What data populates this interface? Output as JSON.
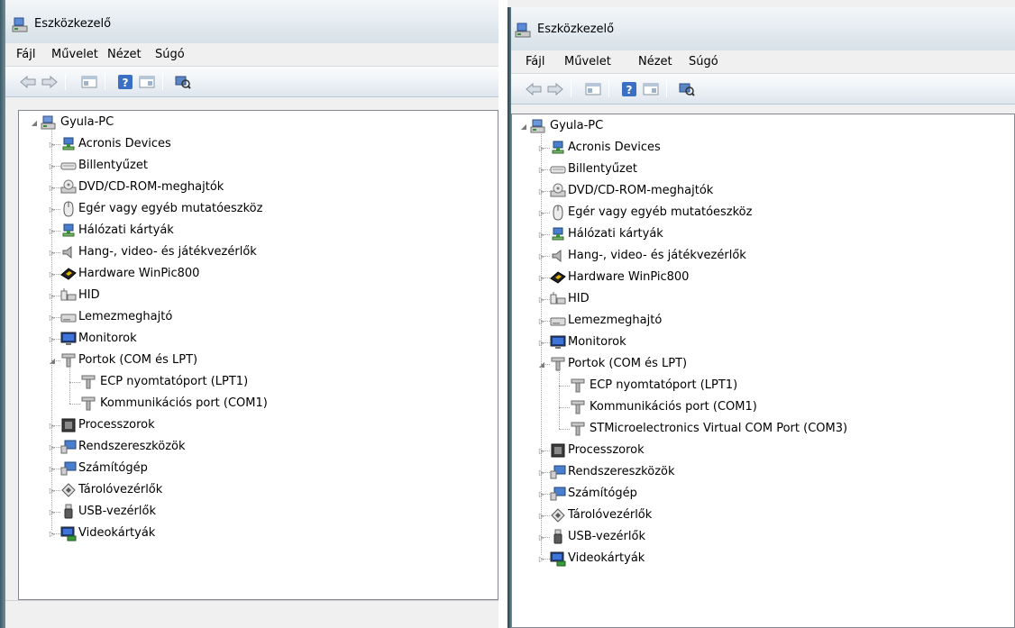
{
  "left_window": {
    "title": "Eszközkezelő",
    "menu": [
      "Fájl",
      "Művelet",
      "Nézet",
      "Súgó"
    ],
    "toolbar_icons": [
      "back-arrow-icon",
      "forward-arrow-icon",
      "properties-view-icon",
      "help-icon",
      "details-view-icon",
      "scan-hardware-icon"
    ],
    "root": "Gyula-PC",
    "categories": [
      {
        "label": "Acronis Devices",
        "icon": "network-icon"
      },
      {
        "label": "Billentyűzet",
        "icon": "keyboard-icon"
      },
      {
        "label": "DVD/CD-ROM-meghajtók",
        "icon": "dvd-drive-icon"
      },
      {
        "label": "Egér vagy egyéb mutatóeszköz",
        "icon": "mouse-icon"
      },
      {
        "label": "Hálózati kártyák",
        "icon": "network-card-icon"
      },
      {
        "label": "Hang-, video- és játékvezérlők",
        "icon": "speaker-icon"
      },
      {
        "label": "Hardware WinPic800",
        "icon": "chip-icon"
      },
      {
        "label": "HID",
        "icon": "hid-icon"
      },
      {
        "label": "Lemezmeghajtó",
        "icon": "disk-drive-icon"
      },
      {
        "label": "Monitorok",
        "icon": "monitor-icon"
      },
      {
        "label": "Portok (COM és LPT)",
        "icon": "port-icon",
        "expanded": true,
        "children": [
          "ECP nyomtatóport (LPT1)",
          "Kommunikációs port (COM1)"
        ]
      },
      {
        "label": "Processzorok",
        "icon": "processor-icon"
      },
      {
        "label": "Rendszereszközök",
        "icon": "system-devices-icon"
      },
      {
        "label": "Számítógép",
        "icon": "computer-icon"
      },
      {
        "label": "Tárolóvezérlők",
        "icon": "storage-controller-icon"
      },
      {
        "label": "USB-vezérlők",
        "icon": "usb-icon"
      },
      {
        "label": "Videokártyák",
        "icon": "video-card-icon"
      }
    ]
  },
  "right_window": {
    "title": "Eszközkezelő",
    "menu": [
      "Fájl",
      "Művelet",
      "Nézet",
      "Súgó"
    ],
    "toolbar_icons": [
      "back-arrow-icon",
      "forward-arrow-icon",
      "properties-view-icon",
      "help-icon",
      "details-view-icon",
      "scan-hardware-icon"
    ],
    "root": "Gyula-PC",
    "categories": [
      {
        "label": "Acronis Devices",
        "icon": "network-icon"
      },
      {
        "label": "Billentyűzet",
        "icon": "keyboard-icon"
      },
      {
        "label": "DVD/CD-ROM-meghajtók",
        "icon": "dvd-drive-icon"
      },
      {
        "label": "Egér vagy egyéb mutatóeszköz",
        "icon": "mouse-icon"
      },
      {
        "label": "Hálózati kártyák",
        "icon": "network-card-icon"
      },
      {
        "label": "Hang-, video- és játékvezérlők",
        "icon": "speaker-icon"
      },
      {
        "label": "Hardware WinPic800",
        "icon": "chip-icon"
      },
      {
        "label": "HID",
        "icon": "hid-icon"
      },
      {
        "label": "Lemezmeghajtó",
        "icon": "disk-drive-icon"
      },
      {
        "label": "Monitorok",
        "icon": "monitor-icon"
      },
      {
        "label": "Portok (COM és LPT)",
        "icon": "port-icon",
        "expanded": true,
        "children": [
          "ECP nyomtatóport (LPT1)",
          "Kommunikációs port (COM1)",
          "STMicroelectronics Virtual COM Port (COM3)"
        ]
      },
      {
        "label": "Processzorok",
        "icon": "processor-icon"
      },
      {
        "label": "Rendszereszközök",
        "icon": "system-devices-icon"
      },
      {
        "label": "Számítógép",
        "icon": "computer-icon"
      },
      {
        "label": "Tárolóvezérlők",
        "icon": "storage-controller-icon"
      },
      {
        "label": "USB-vezérlők",
        "icon": "usb-icon"
      },
      {
        "label": "Videokártyák",
        "icon": "video-card-icon"
      }
    ]
  }
}
